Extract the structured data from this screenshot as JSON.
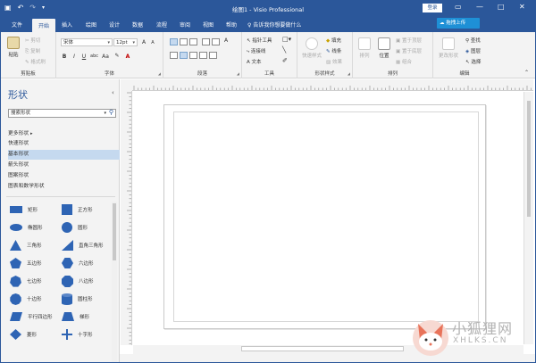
{
  "titlebar": {
    "title": "绘图1 - Visio Professional",
    "login": "登录",
    "save_icon": "save-icon",
    "undo_icon": "undo-icon",
    "redo_icon": "redo-icon"
  },
  "tabs": [
    "文件",
    "开始",
    "插入",
    "绘图",
    "设计",
    "数据",
    "流程",
    "审阅",
    "视图",
    "帮助"
  ],
  "active_tab": "开始",
  "tell_me": "告诉我你想要做什么",
  "cloud": "拖拽上传",
  "share": "共享",
  "clipboard": {
    "paste": "粘贴",
    "cut": "剪切",
    "copy": "复制",
    "format": "格式刷",
    "label": "剪贴板"
  },
  "font": {
    "name": "宋体",
    "size": "12pt",
    "label": "字体"
  },
  "paragraph": {
    "label": "段落"
  },
  "tools": {
    "pointer": "指针工具",
    "connector": "连接线",
    "text": "文本",
    "label": "工具"
  },
  "shape_styles": {
    "quick_styles": "快速样式",
    "fill": "填充",
    "line": "线条",
    "effects": "效果",
    "label": "形状样式"
  },
  "arrange": {
    "align": "排列",
    "position": "位置",
    "bring_front": "置于顶层",
    "send_back": "置于底层",
    "group": "组合",
    "label": "排列"
  },
  "editing": {
    "change_shape": "更改形状",
    "find": "查找",
    "layers": "图层",
    "select": "选择",
    "label": "编辑"
  },
  "pane": {
    "title": "形状",
    "search_placeholder": "搜索形状",
    "more": "更多形状",
    "stencils": [
      "快速形状",
      "基本形状",
      "箭头形状",
      "图案形状",
      "图表和数学形状"
    ],
    "selected_stencil": "基本形状",
    "shapes": [
      "矩形",
      "正方形",
      "椭圆形",
      "圆形",
      "三角形",
      "直角三角形",
      "五边形",
      "六边形",
      "七边形",
      "八边形",
      "十边形",
      "圆柱形",
      "平行四边形",
      "梯形",
      "菱形",
      "十字形"
    ]
  },
  "watermark": {
    "text": "小狐狸网",
    "sub": "XHLKS.CN"
  },
  "colors": {
    "accent": "#2b579a",
    "ribbon": "#f3f3f3",
    "shape_blue": "#2e64b4",
    "selected": "#c5d9ef"
  }
}
